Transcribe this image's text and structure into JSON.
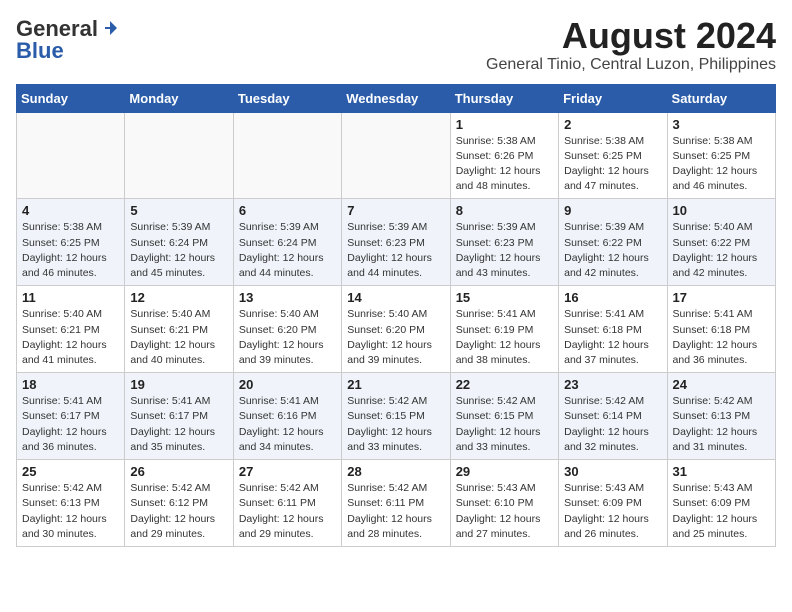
{
  "logo": {
    "general": "General",
    "blue": "Blue"
  },
  "title": "August 2024",
  "subtitle": "General Tinio, Central Luzon, Philippines",
  "days_of_week": [
    "Sunday",
    "Monday",
    "Tuesday",
    "Wednesday",
    "Thursday",
    "Friday",
    "Saturday"
  ],
  "weeks": [
    [
      {
        "day": "",
        "empty": true
      },
      {
        "day": "",
        "empty": true
      },
      {
        "day": "",
        "empty": true
      },
      {
        "day": "",
        "empty": true
      },
      {
        "day": "1",
        "sunrise": "Sunrise: 5:38 AM",
        "sunset": "Sunset: 6:26 PM",
        "daylight": "Daylight: 12 hours and 48 minutes."
      },
      {
        "day": "2",
        "sunrise": "Sunrise: 5:38 AM",
        "sunset": "Sunset: 6:25 PM",
        "daylight": "Daylight: 12 hours and 47 minutes."
      },
      {
        "day": "3",
        "sunrise": "Sunrise: 5:38 AM",
        "sunset": "Sunset: 6:25 PM",
        "daylight": "Daylight: 12 hours and 46 minutes."
      }
    ],
    [
      {
        "day": "4",
        "sunrise": "Sunrise: 5:38 AM",
        "sunset": "Sunset: 6:25 PM",
        "daylight": "Daylight: 12 hours and 46 minutes."
      },
      {
        "day": "5",
        "sunrise": "Sunrise: 5:39 AM",
        "sunset": "Sunset: 6:24 PM",
        "daylight": "Daylight: 12 hours and 45 minutes."
      },
      {
        "day": "6",
        "sunrise": "Sunrise: 5:39 AM",
        "sunset": "Sunset: 6:24 PM",
        "daylight": "Daylight: 12 hours and 44 minutes."
      },
      {
        "day": "7",
        "sunrise": "Sunrise: 5:39 AM",
        "sunset": "Sunset: 6:23 PM",
        "daylight": "Daylight: 12 hours and 44 minutes."
      },
      {
        "day": "8",
        "sunrise": "Sunrise: 5:39 AM",
        "sunset": "Sunset: 6:23 PM",
        "daylight": "Daylight: 12 hours and 43 minutes."
      },
      {
        "day": "9",
        "sunrise": "Sunrise: 5:39 AM",
        "sunset": "Sunset: 6:22 PM",
        "daylight": "Daylight: 12 hours and 42 minutes."
      },
      {
        "day": "10",
        "sunrise": "Sunrise: 5:40 AM",
        "sunset": "Sunset: 6:22 PM",
        "daylight": "Daylight: 12 hours and 42 minutes."
      }
    ],
    [
      {
        "day": "11",
        "sunrise": "Sunrise: 5:40 AM",
        "sunset": "Sunset: 6:21 PM",
        "daylight": "Daylight: 12 hours and 41 minutes."
      },
      {
        "day": "12",
        "sunrise": "Sunrise: 5:40 AM",
        "sunset": "Sunset: 6:21 PM",
        "daylight": "Daylight: 12 hours and 40 minutes."
      },
      {
        "day": "13",
        "sunrise": "Sunrise: 5:40 AM",
        "sunset": "Sunset: 6:20 PM",
        "daylight": "Daylight: 12 hours and 39 minutes."
      },
      {
        "day": "14",
        "sunrise": "Sunrise: 5:40 AM",
        "sunset": "Sunset: 6:20 PM",
        "daylight": "Daylight: 12 hours and 39 minutes."
      },
      {
        "day": "15",
        "sunrise": "Sunrise: 5:41 AM",
        "sunset": "Sunset: 6:19 PM",
        "daylight": "Daylight: 12 hours and 38 minutes."
      },
      {
        "day": "16",
        "sunrise": "Sunrise: 5:41 AM",
        "sunset": "Sunset: 6:18 PM",
        "daylight": "Daylight: 12 hours and 37 minutes."
      },
      {
        "day": "17",
        "sunrise": "Sunrise: 5:41 AM",
        "sunset": "Sunset: 6:18 PM",
        "daylight": "Daylight: 12 hours and 36 minutes."
      }
    ],
    [
      {
        "day": "18",
        "sunrise": "Sunrise: 5:41 AM",
        "sunset": "Sunset: 6:17 PM",
        "daylight": "Daylight: 12 hours and 36 minutes."
      },
      {
        "day": "19",
        "sunrise": "Sunrise: 5:41 AM",
        "sunset": "Sunset: 6:17 PM",
        "daylight": "Daylight: 12 hours and 35 minutes."
      },
      {
        "day": "20",
        "sunrise": "Sunrise: 5:41 AM",
        "sunset": "Sunset: 6:16 PM",
        "daylight": "Daylight: 12 hours and 34 minutes."
      },
      {
        "day": "21",
        "sunrise": "Sunrise: 5:42 AM",
        "sunset": "Sunset: 6:15 PM",
        "daylight": "Daylight: 12 hours and 33 minutes."
      },
      {
        "day": "22",
        "sunrise": "Sunrise: 5:42 AM",
        "sunset": "Sunset: 6:15 PM",
        "daylight": "Daylight: 12 hours and 33 minutes."
      },
      {
        "day": "23",
        "sunrise": "Sunrise: 5:42 AM",
        "sunset": "Sunset: 6:14 PM",
        "daylight": "Daylight: 12 hours and 32 minutes."
      },
      {
        "day": "24",
        "sunrise": "Sunrise: 5:42 AM",
        "sunset": "Sunset: 6:13 PM",
        "daylight": "Daylight: 12 hours and 31 minutes."
      }
    ],
    [
      {
        "day": "25",
        "sunrise": "Sunrise: 5:42 AM",
        "sunset": "Sunset: 6:13 PM",
        "daylight": "Daylight: 12 hours and 30 minutes."
      },
      {
        "day": "26",
        "sunrise": "Sunrise: 5:42 AM",
        "sunset": "Sunset: 6:12 PM",
        "daylight": "Daylight: 12 hours and 29 minutes."
      },
      {
        "day": "27",
        "sunrise": "Sunrise: 5:42 AM",
        "sunset": "Sunset: 6:11 PM",
        "daylight": "Daylight: 12 hours and 29 minutes."
      },
      {
        "day": "28",
        "sunrise": "Sunrise: 5:42 AM",
        "sunset": "Sunset: 6:11 PM",
        "daylight": "Daylight: 12 hours and 28 minutes."
      },
      {
        "day": "29",
        "sunrise": "Sunrise: 5:43 AM",
        "sunset": "Sunset: 6:10 PM",
        "daylight": "Daylight: 12 hours and 27 minutes."
      },
      {
        "day": "30",
        "sunrise": "Sunrise: 5:43 AM",
        "sunset": "Sunset: 6:09 PM",
        "daylight": "Daylight: 12 hours and 26 minutes."
      },
      {
        "day": "31",
        "sunrise": "Sunrise: 5:43 AM",
        "sunset": "Sunset: 6:09 PM",
        "daylight": "Daylight: 12 hours and 25 minutes."
      }
    ]
  ]
}
